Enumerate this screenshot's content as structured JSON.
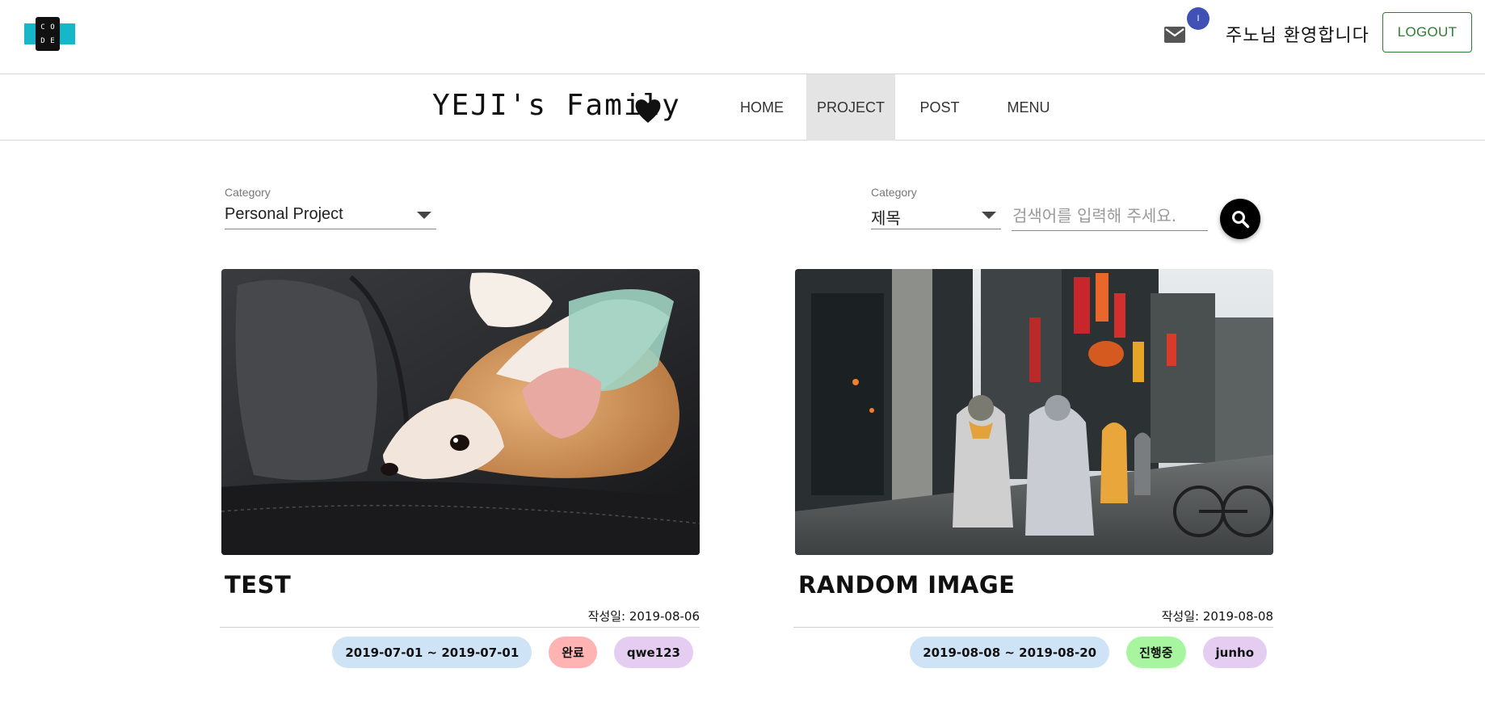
{
  "header": {
    "logo_letters": [
      "C",
      "O",
      "D",
      "E"
    ],
    "mail_badge_count": "I",
    "welcome_text": "주노님 환영합니다",
    "logout_label": "LOGOUT"
  },
  "nav": {
    "brand": "YEJI's Family",
    "tabs": [
      {
        "label": "HOME",
        "active": false
      },
      {
        "label": "PROJECT",
        "active": true
      },
      {
        "label": "POST",
        "active": false
      },
      {
        "label": "MENU",
        "active": false
      }
    ]
  },
  "filters": {
    "category_label": "Category",
    "category_value": "Personal Project",
    "search_category_label": "Category",
    "search_category_value": "제목",
    "search_placeholder": "검색어를 입력해 주세요."
  },
  "cards": [
    {
      "title": "TEST",
      "created": "작성일: 2019-08-06",
      "period": "2019-07-01 ~ 2019-07-01",
      "status": "완료",
      "status_color": "#ffb3b3",
      "author": "qwe123"
    },
    {
      "title": "RANDOM IMAGE",
      "created": "작성일: 2019-08-08",
      "period": "2019-08-08 ~ 2019-08-20",
      "status": "진행중",
      "status_color": "#a8f5a0",
      "author": "junho"
    }
  ],
  "colors": {
    "logo_band": "#16b7c9",
    "badge": "#3f51b5",
    "logout": "#2e7d32",
    "period_chip": "#cfe3f7",
    "author_chip": "#e5cdf2",
    "active_tab": "#e4e4e4"
  },
  "icons": {
    "mail": "mail-icon",
    "heart": "heart-icon",
    "search": "search-icon",
    "dropdown": "caret-down-icon"
  }
}
